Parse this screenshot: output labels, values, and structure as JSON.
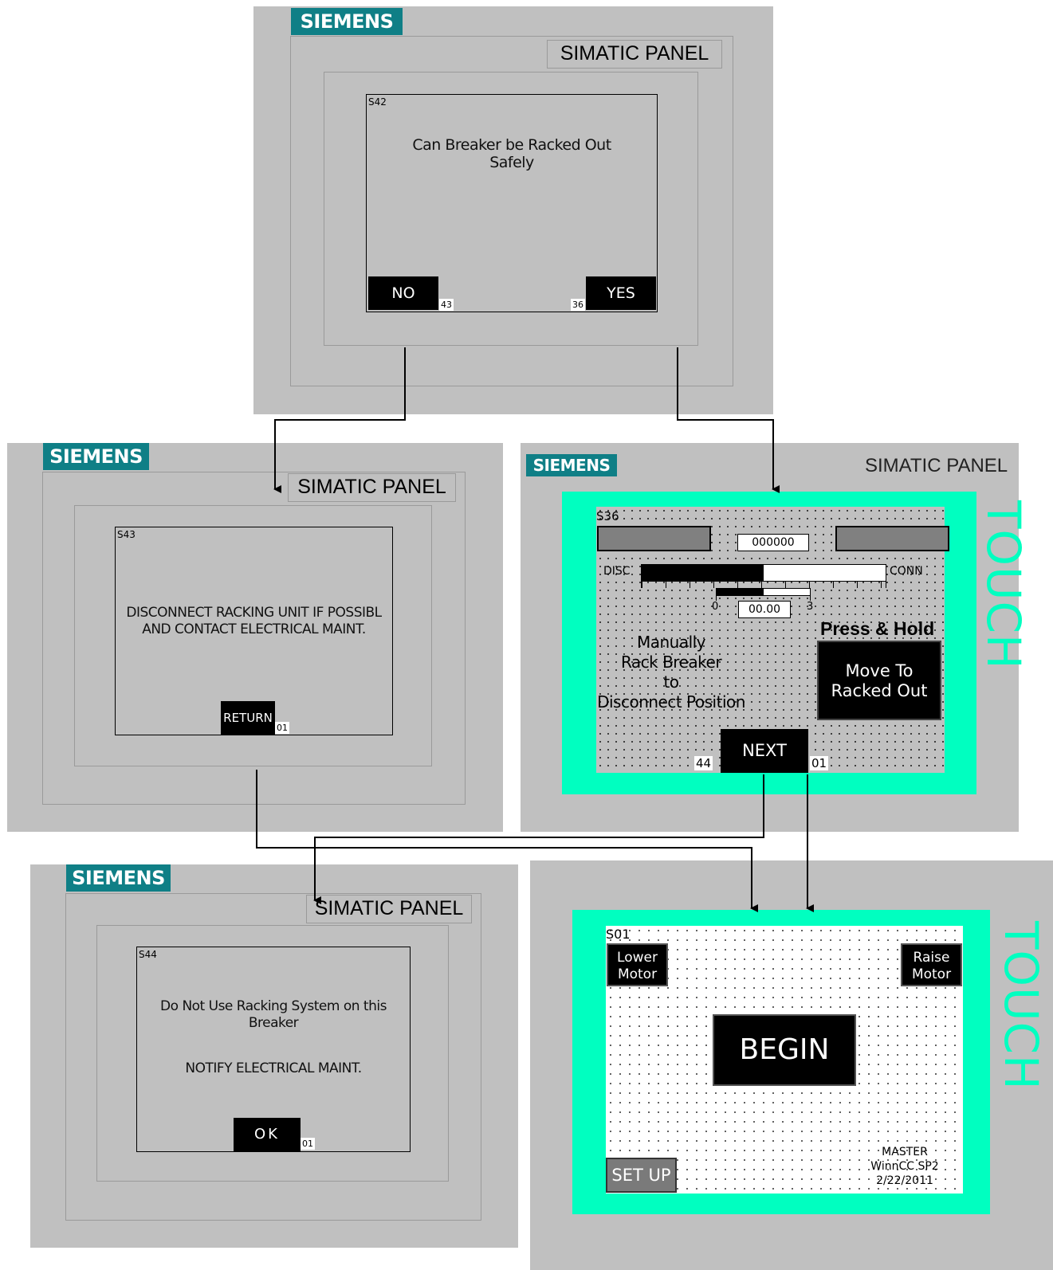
{
  "panel_s42": {
    "brand": "SIEMENS",
    "model": "SIMATIC PANEL",
    "screen_id": "S42",
    "message_line1": "Can Breaker be Racked Out",
    "message_line2": "Safely",
    "no_label": "NO",
    "no_target": "43",
    "yes_label": "YES",
    "yes_target": "36"
  },
  "panel_s43": {
    "brand": "SIEMENS",
    "model": "SIMATIC PANEL",
    "screen_id": "S43",
    "message_line1": "DISCONNECT RACKING UNIT IF POSSIBL",
    "message_line2": "AND CONTACT ELECTRICAL MAINT.",
    "return_label": "RETURN",
    "return_target": "01"
  },
  "panel_s36": {
    "brand": "SIEMENS",
    "model": "SIMATIC PANEL",
    "touch": "TOUCH",
    "screen_id": "S36",
    "counter": "000000",
    "disc_label": "DISC",
    "conn_label": "CONN",
    "position_fraction": 0.5,
    "small_bar_fraction": 0.5,
    "scale_min": "0",
    "scale_max": "3",
    "value": "00.00",
    "press_hold": "Press & Hold",
    "move_line1": "Move To",
    "move_line2": "Racked Out",
    "instr_line1": "Manually",
    "instr_line2": "Rack Breaker",
    "instr_line3": "to",
    "instr_line4": "Disconnect Position",
    "next_label": "NEXT",
    "next_left_target": "44",
    "next_right_target": "01"
  },
  "panel_s44": {
    "brand": "SIEMENS",
    "model": "SIMATIC PANEL",
    "screen_id": "S44",
    "message_line1": "Do Not Use Racking System on this",
    "message_line2": "Breaker",
    "message_line3": "NOTIFY ELECTRICAL MAINT.",
    "ok_label": "OK",
    "ok_target": "01"
  },
  "panel_s01": {
    "touch": "TOUCH",
    "screen_id": "S01",
    "lower_line1": "Lower",
    "lower_line2": "Motor",
    "raise_line1": "Raise",
    "raise_line2": "Motor",
    "begin_label": "BEGIN",
    "setup_label": "SET UP",
    "footer_line1": "MASTER",
    "footer_line2": "WinnCC SP2",
    "footer_line3": "2/22/2011"
  },
  "colors": {
    "siemens_teal": "#0f7f86",
    "touch_cyan": "#00ffc0",
    "panel_grey": "#c0c0c0"
  }
}
